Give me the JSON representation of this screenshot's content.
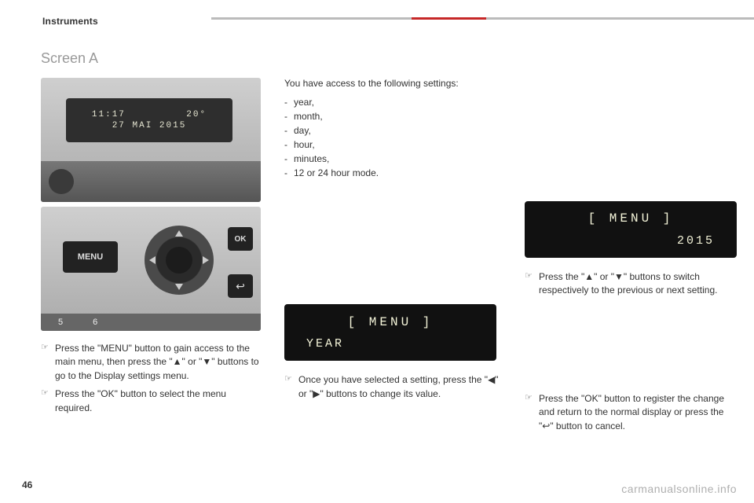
{
  "header": {
    "section": "Instruments"
  },
  "heading": "Screen A",
  "photo1": {
    "lcd_top": "11:17         20°",
    "lcd_bottom": "27 MAI 2015"
  },
  "photo2": {
    "menu_label": "MENU",
    "ok_label": "OK",
    "back_glyph": "↩",
    "num5": "5",
    "num6": "6"
  },
  "col1_instr": [
    "Press the \"MENU\" button to gain access to the main menu, then press the \"▲\" or \"▼\" buttons to go to the Display settings menu.",
    "Press the \"OK\" button to select the menu required."
  ],
  "col2": {
    "intro": "You have access to the following settings:",
    "settings": [
      "year,",
      "month,",
      "day,",
      "hour,",
      "minutes,",
      "12 or 24 hour mode."
    ],
    "lcd_row1": "[    MENU    ]",
    "lcd_row2": "YEAR",
    "instr": "Once you have selected a setting, press the \"◀\" or \"▶\" buttons to change its value."
  },
  "col3": {
    "lcd_row1": "[    MENU    ]",
    "lcd_row2": "2015",
    "instr_top": "Press the \"▲\" or \"▼\" buttons to switch respectively to the previous or next setting.",
    "instr_bottom": "Press the \"OK\" button to register the change and return to the normal display or press the \"↩\" button to cancel."
  },
  "footer": {
    "page": "46",
    "watermark": "carmanualsonline.info"
  },
  "chart_data": {
    "type": "table",
    "title": "Display settings list",
    "rows": [
      "year",
      "month",
      "day",
      "hour",
      "minutes",
      "12 or 24 hour mode"
    ]
  }
}
